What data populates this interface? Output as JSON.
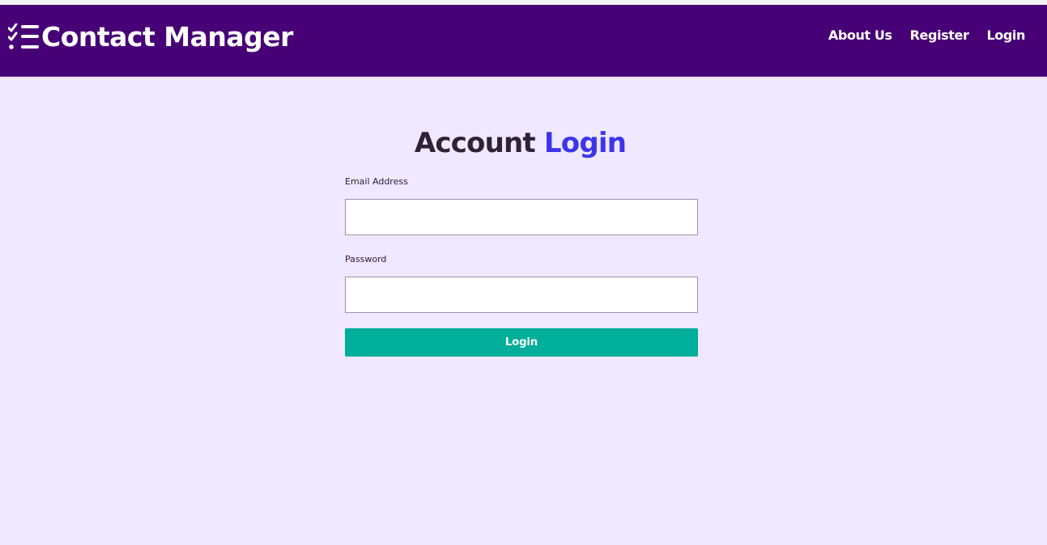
{
  "navbar": {
    "brand_icon": "checklist-icon",
    "brand_title": "Contact Manager",
    "links": [
      {
        "label": "About Us"
      },
      {
        "label": "Register"
      },
      {
        "label": "Login"
      }
    ],
    "background_color": "#470075"
  },
  "login_form": {
    "heading_main": "Account",
    "heading_accent": "Login",
    "email_label": "Email Address",
    "email_value": "",
    "password_label": "Password",
    "password_value": "",
    "submit_label": "Login",
    "accent_color": "#3c35ea",
    "button_color": "#00ae9b"
  },
  "page": {
    "background_color": "#f0e8ff"
  }
}
